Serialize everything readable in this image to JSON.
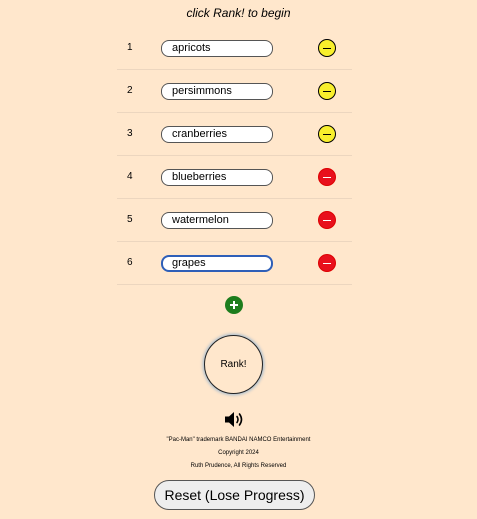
{
  "instruction": "click Rank! to begin",
  "items": [
    {
      "num": "1",
      "value": "apricots",
      "remove_color": "yellow"
    },
    {
      "num": "2",
      "value": "persimmons",
      "remove_color": "yellow"
    },
    {
      "num": "3",
      "value": "cranberries",
      "remove_color": "yellow"
    },
    {
      "num": "4",
      "value": "blueberries",
      "remove_color": "red"
    },
    {
      "num": "5",
      "value": "watermelon",
      "remove_color": "red"
    },
    {
      "num": "6",
      "value": "grapes",
      "remove_color": "red"
    }
  ],
  "rank_label": "Rank!",
  "footer": {
    "trademark": "\"Pac-Man\" trademark BANDAI NAMCO Entertainment",
    "copyright": "Copyright 2024",
    "rights": "Ruth Prudence, All Rights Reserved"
  },
  "reset_label": "Reset (Lose Progress)",
  "colors": {
    "background": "#ffe7cc",
    "remove_yellow": "#f8ef2c",
    "remove_red": "#e8101c",
    "add_green": "#1d7d1d",
    "focus_border": "#2e5fb8"
  },
  "icons": {
    "add": "plus-icon",
    "remove": "minus-icon",
    "sound": "speaker-icon"
  }
}
